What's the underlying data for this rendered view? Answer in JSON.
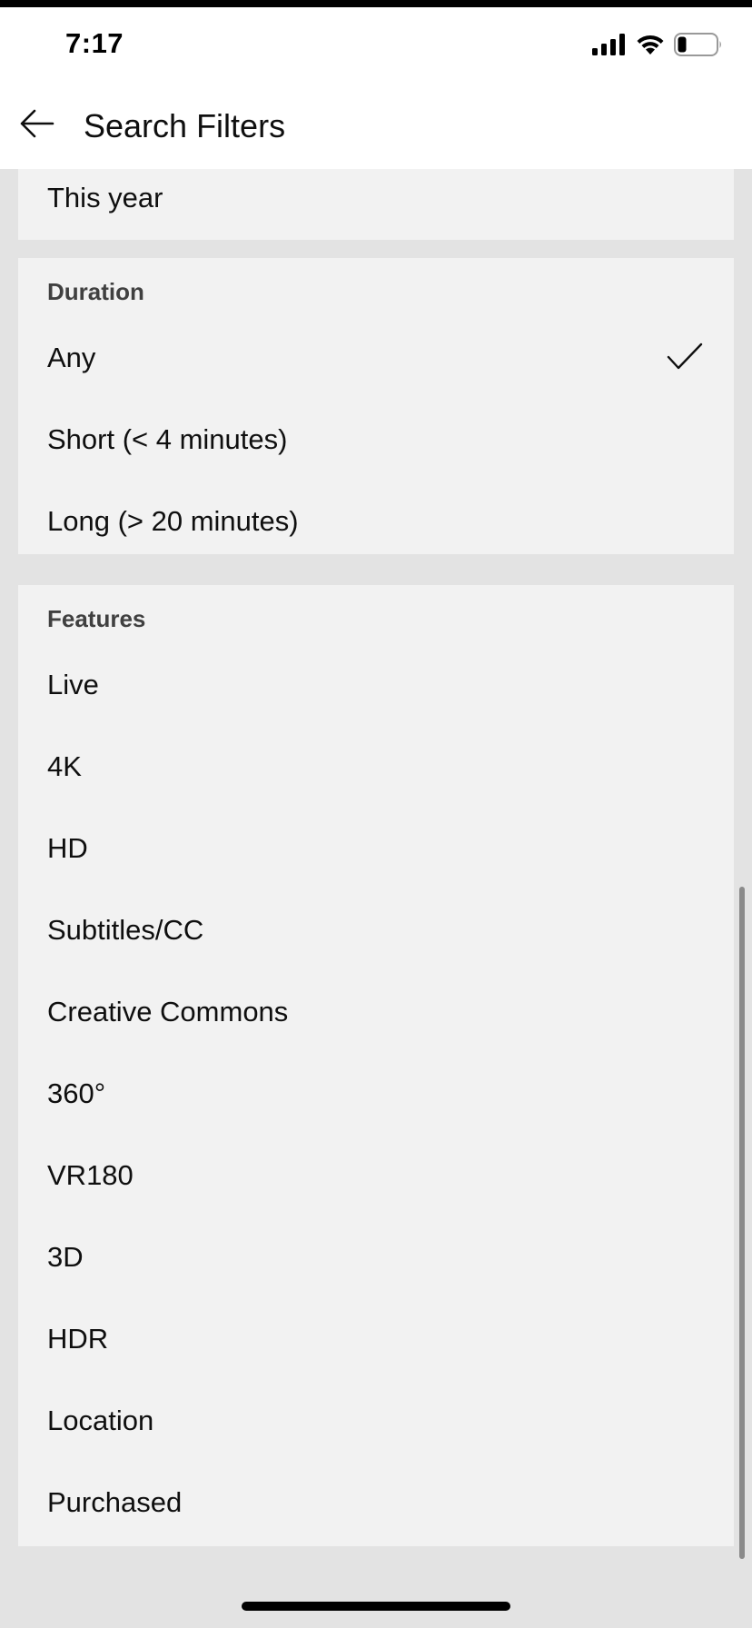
{
  "status_bar": {
    "time": "7:17",
    "icons": [
      "cellular-signal-icon",
      "wifi-icon",
      "battery-icon"
    ]
  },
  "app_bar": {
    "back_icon": "arrow-left-icon",
    "title": "Search Filters"
  },
  "upload_date_section": {
    "visible_options": [
      "This year"
    ]
  },
  "duration_section": {
    "title": "Duration",
    "options": [
      "Any",
      "Short (< 4 minutes)",
      "Long (> 20 minutes)"
    ],
    "selected": "Any"
  },
  "features_section": {
    "title": "Features",
    "options": [
      "Live",
      "4K",
      "HD",
      "Subtitles/CC",
      "Creative Commons",
      "360°",
      "VR180",
      "3D",
      "HDR",
      "Location",
      "Purchased"
    ]
  },
  "colors": {
    "card_bg": "#f2f2f2",
    "page_bg": "#e3e3e3",
    "text": "#0f0f0f",
    "section_title": "#404040"
  }
}
